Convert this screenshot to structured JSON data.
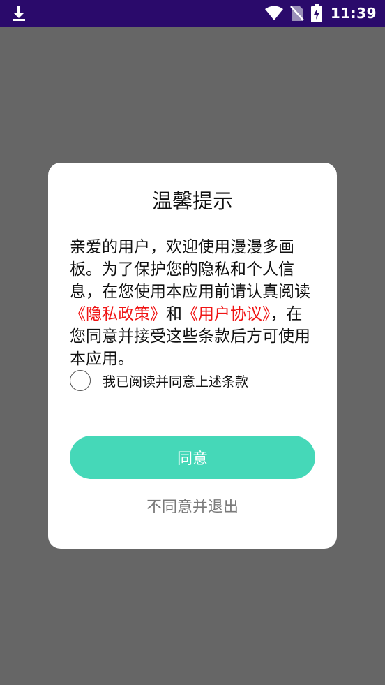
{
  "status_bar": {
    "time": "11:39",
    "icons": [
      "download-icon",
      "wifi-icon",
      "no-sim-icon",
      "battery-charging-icon"
    ],
    "background": "#2a0a6b"
  },
  "dialog": {
    "title": "温馨提示",
    "body": {
      "intro": "亲爱的用户，欢迎使用漫漫多画板。为了保护您的隐私和个人信息，在您使用本应用前请认真阅读",
      "privacy_link": "《隐私政策》",
      "and": "和",
      "agreement_link": "《用户协议》",
      "outro": "，在您同意并接受这些条款后方可使用本应用。"
    },
    "checkbox_label": "我已阅读并同意上述条款",
    "agree_button": "同意",
    "decline_link": "不同意并退出"
  },
  "colors": {
    "overlay": "#666666",
    "accent": "#45d8b8",
    "link": "#f01414",
    "decline_text": "#7a7a7a"
  }
}
